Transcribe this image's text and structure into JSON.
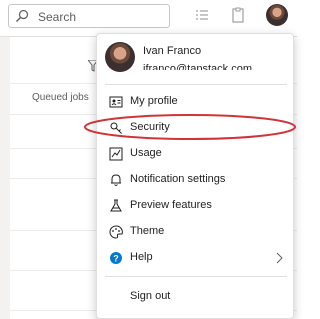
{
  "search": {
    "placeholder": "Search"
  },
  "table": {
    "column_queued": "Queued jobs"
  },
  "user": {
    "name": "Ivan Franco",
    "email": "ifranco@tapstack.com"
  },
  "menu": {
    "items": [
      {
        "label": "My profile",
        "icon": "profile-card-icon"
      },
      {
        "label": "Security",
        "icon": "key-icon"
      },
      {
        "label": "Usage",
        "icon": "usage-icon"
      },
      {
        "label": "Notification settings",
        "icon": "bell-icon"
      },
      {
        "label": "Preview features",
        "icon": "flask-icon"
      },
      {
        "label": "Theme",
        "icon": "palette-icon"
      },
      {
        "label": "Help",
        "icon": "help-icon"
      }
    ],
    "sign_out": "Sign out"
  },
  "colors": {
    "help_blue": "#0078d4",
    "annotation_red": "#d13438"
  }
}
